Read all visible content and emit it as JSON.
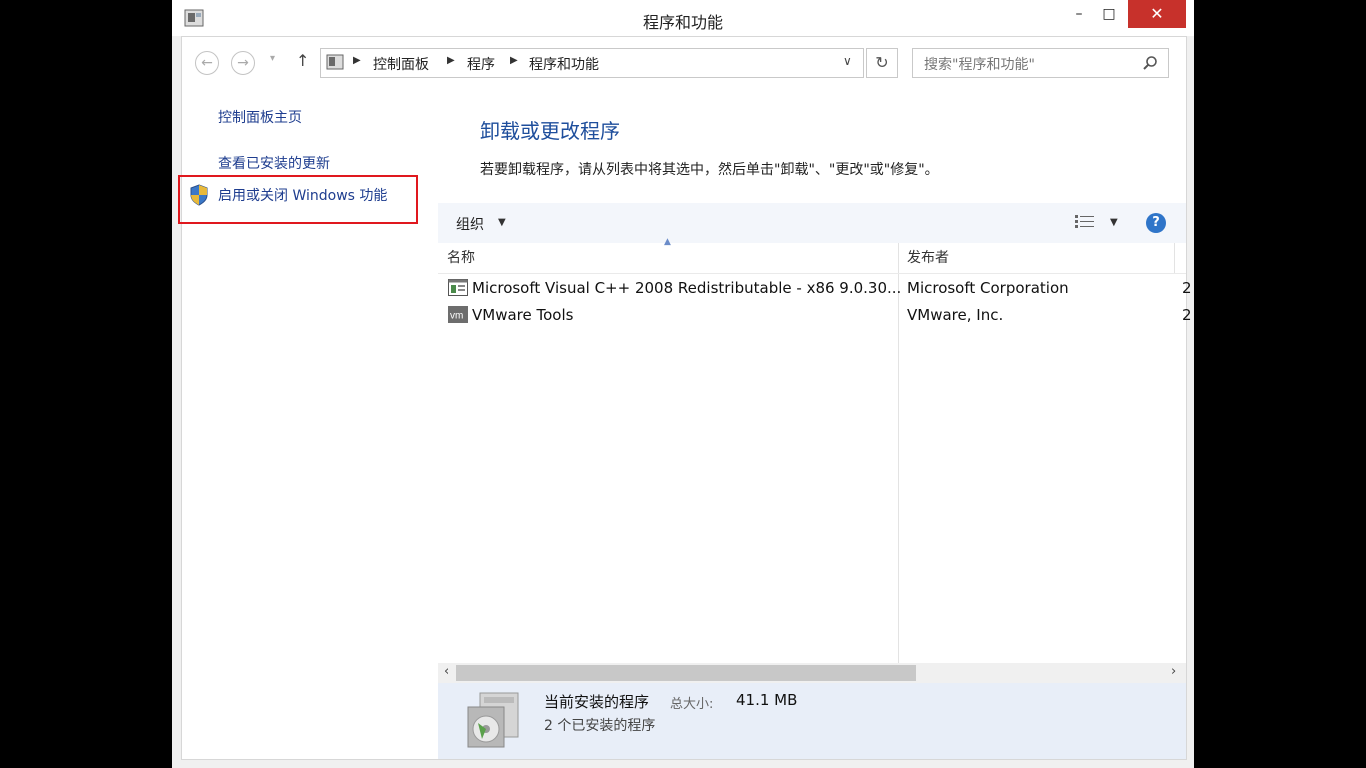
{
  "window": {
    "title": "程序和功能"
  },
  "controls": {
    "minimize": "–",
    "maximize": "□",
    "close": "✕"
  },
  "nav": {
    "back": "←",
    "forward": "→",
    "recent": "▾",
    "up": "↑",
    "breadcrumbs": [
      "控制面板",
      "程序",
      "程序和功能"
    ],
    "refresh": "↻",
    "search_placeholder": "搜索\"程序和功能\""
  },
  "left_nav": {
    "items": [
      {
        "label": "控制面板主页"
      },
      {
        "label": "查看已安装的更新"
      },
      {
        "label": "启用或关闭 Windows 功能"
      }
    ]
  },
  "main": {
    "heading": "卸载或更改程序",
    "instruction": "若要卸载程序，请从列表中将其选中，然后单击\"卸载\"、\"更改\"或\"修复\"。"
  },
  "toolbar": {
    "organize": "组织",
    "help": "?"
  },
  "list": {
    "columns": [
      "名称",
      "发布者"
    ],
    "rows": [
      {
        "name": "Microsoft Visual C++ 2008 Redistributable - x86 9.0.30...",
        "publisher": "Microsoft Corporation",
        "extra": "2",
        "icon": "installer-icon"
      },
      {
        "name": "VMware Tools",
        "publisher": "VMware, Inc.",
        "extra": "2",
        "icon": "vmware-icon"
      }
    ]
  },
  "details": {
    "title": "当前安装的程序",
    "size_label": "总大小:",
    "size_value": "41.1 MB",
    "count": "2 个已安装的程序"
  },
  "colors": {
    "accent": "#1e4e9c",
    "link": "#1e3d8f",
    "close": "#c7312b",
    "highlight": "#e0181e"
  }
}
